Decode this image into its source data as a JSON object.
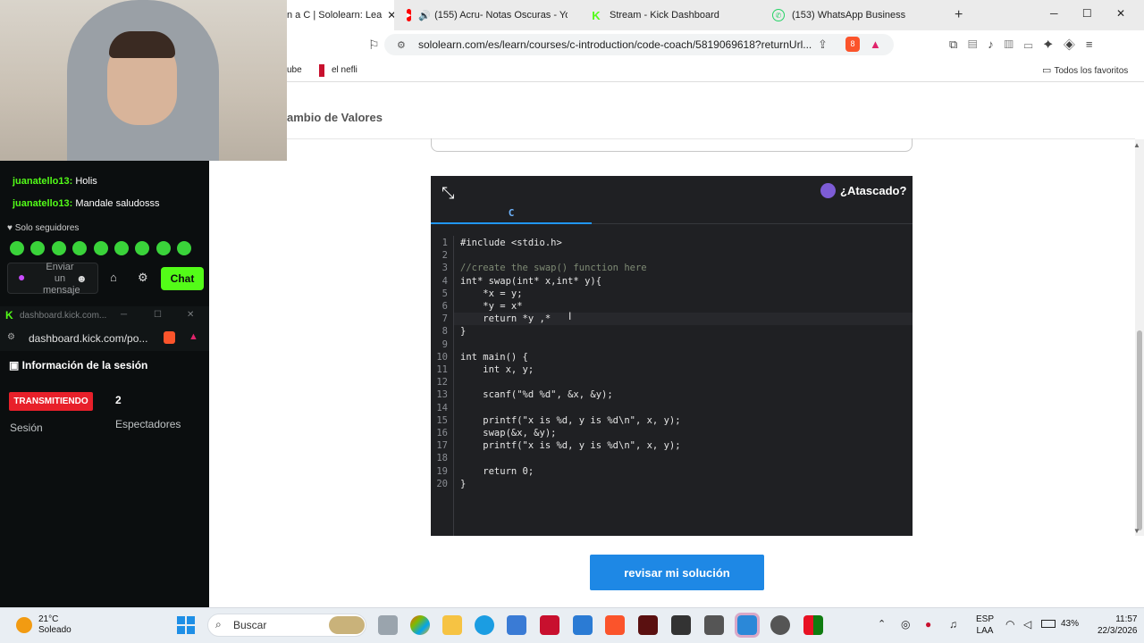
{
  "browser": {
    "tabs": [
      {
        "label": "n a C | Sololearn: Lea",
        "icon": "sololearn-icon",
        "active": true
      },
      {
        "label": "(155) Acru- Notas Oscuras - YouT",
        "icon": "youtube-icon",
        "active": false
      },
      {
        "label": "Stream - Kick Dashboard",
        "icon": "kick-icon",
        "active": false
      },
      {
        "label": "(153) WhatsApp Business",
        "icon": "whatsapp-icon",
        "active": false
      }
    ],
    "url": "sololearn.com/es/learn/courses/c-introduction/code-coach/5819069618?returnUrl...",
    "bookmarks": [
      {
        "label": "ube"
      },
      {
        "label": "el nefli"
      }
    ],
    "all_bookmarks": "Todos los favoritos",
    "brave_badge": "8"
  },
  "lesson": {
    "title": "ambio de Valores"
  },
  "editor": {
    "language": "C",
    "stuck_label": "¿Atascado?",
    "lines": [
      {
        "n": "1",
        "code": "#include <stdio.h>"
      },
      {
        "n": "2",
        "code": ""
      },
      {
        "n": "3",
        "code": "//create the swap() function here"
      },
      {
        "n": "4",
        "code": "int* swap(int* x,int* y){"
      },
      {
        "n": "5",
        "code": "    *x = y;"
      },
      {
        "n": "6",
        "code": "    *y = x*"
      },
      {
        "n": "7",
        "code": "    return *y ,*"
      },
      {
        "n": "8",
        "code": "}"
      },
      {
        "n": "9",
        "code": ""
      },
      {
        "n": "10",
        "code": "int main() {"
      },
      {
        "n": "11",
        "code": "    int x, y;"
      },
      {
        "n": "12",
        "code": ""
      },
      {
        "n": "13",
        "code": "    scanf(\"%d %d\", &x, &y);"
      },
      {
        "n": "14",
        "code": ""
      },
      {
        "n": "15",
        "code": "    printf(\"x is %d, y is %d\\n\", x, y);"
      },
      {
        "n": "16",
        "code": "    swap(&x, &y);"
      },
      {
        "n": "17",
        "code": "    printf(\"x is %d, y is %d\\n\", x, y);"
      },
      {
        "n": "18",
        "code": ""
      },
      {
        "n": "19",
        "code": "    return 0;"
      },
      {
        "n": "20",
        "code": "}"
      }
    ],
    "submit_label": "revisar mi solución"
  },
  "kick": {
    "chat": [
      {
        "user": "juanatello13:",
        "msg": "Holis"
      },
      {
        "user": "juanatello13:",
        "msg": "Mandale saludosss"
      }
    ],
    "followers_only": "Solo seguidores",
    "input_placeholder": "Enviar un mensaje",
    "chat_button": "Chat",
    "mini_title": "dashboard.kick.com...",
    "mini_url": "dashboard.kick.com/po...",
    "session_title": "Información de la sesión",
    "live_badge": "TRANSMITIENDO",
    "viewer_count": "2",
    "session_label": "Sesión",
    "viewers_label": "Espectadores",
    "accent": "#53fc18"
  },
  "taskbar": {
    "temp": "21°C",
    "condition": "Soleado",
    "search_placeholder": "Buscar",
    "lang_line1": "ESP",
    "lang_line2": "LAA",
    "battery": "43%",
    "time": "11:57",
    "date": "22/3/2026"
  }
}
